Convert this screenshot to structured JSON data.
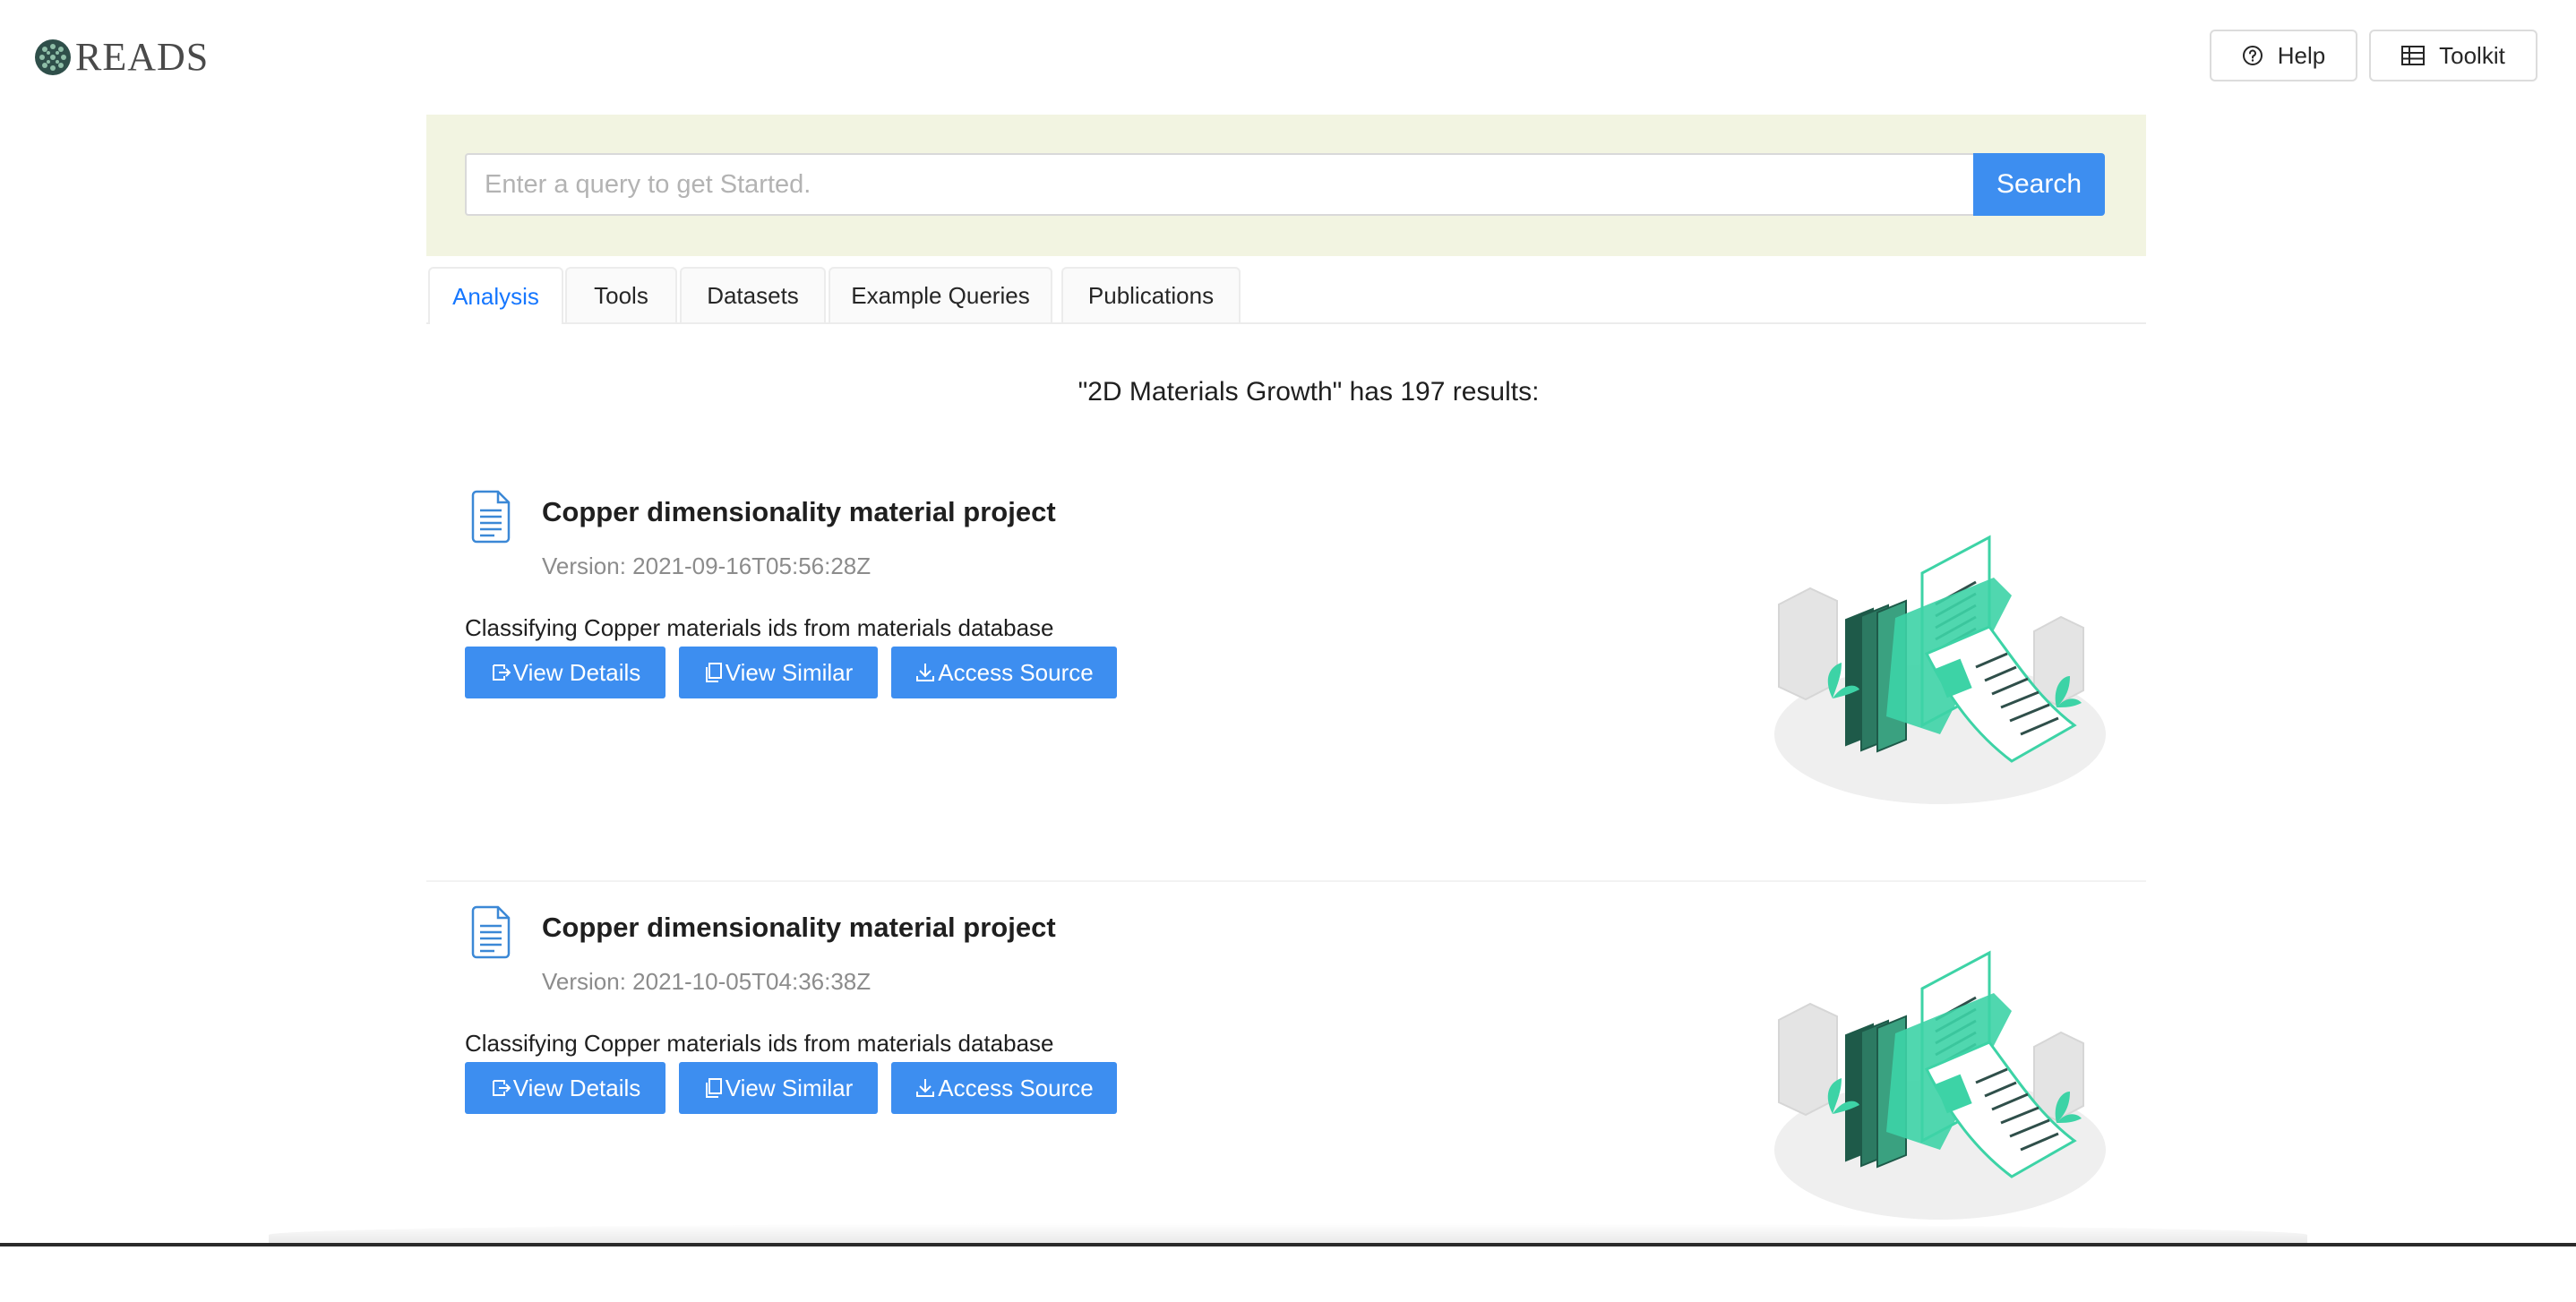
{
  "app": {
    "logo_text": "READS"
  },
  "header": {
    "help_label": "Help",
    "toolkit_label": "Toolkit"
  },
  "search": {
    "placeholder": "Enter a query to get Started.",
    "value": "",
    "button_label": "Search"
  },
  "tabs": [
    {
      "label": "Analysis",
      "active": true
    },
    {
      "label": "Tools",
      "active": false
    },
    {
      "label": "Datasets",
      "active": false
    },
    {
      "label": "Example Queries",
      "active": false
    },
    {
      "label": "Publications",
      "active": false
    }
  ],
  "results_heading": "\"2D Materials Growth\" has 197 results:",
  "results": [
    {
      "title": "Copper dimensionality material project",
      "version": "Version: 2021-09-16T05:56:28Z",
      "description": "Classifying Copper materials ids from materials database",
      "view_details_label": "View Details",
      "view_similar_label": "View Similar",
      "access_source_label": "Access Source"
    },
    {
      "title": "Copper dimensionality material project",
      "version": "Version: 2021-10-05T04:36:38Z",
      "description": "Classifying Copper materials ids from materials database",
      "view_details_label": "View Details",
      "view_similar_label": "View Similar",
      "access_source_label": "Access Source"
    }
  ],
  "colors": {
    "primary": "#3d8ef0",
    "search_area_bg": "#f2f4e1",
    "active_tab": "#1677ff",
    "illustration_green": "#3dd3a6"
  },
  "icons": {
    "help": "question-circle-icon",
    "toolkit": "table-icon",
    "result": "document-icon",
    "view_details": "export-icon",
    "view_similar": "copy-icon",
    "access_source": "download-icon"
  }
}
